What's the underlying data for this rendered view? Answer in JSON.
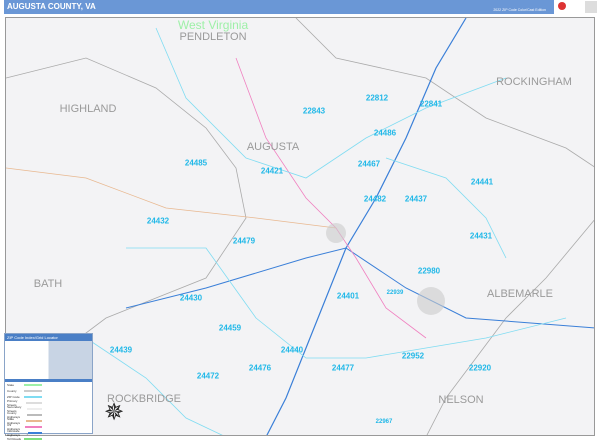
{
  "header": {
    "title": "AUGUSTA COUNTY, VA",
    "edition": "2022 ZIP Code Color/Cast Edition"
  },
  "places": [
    {
      "name": "West Virginia",
      "type": "state"
    },
    {
      "name": "PENDLETON"
    },
    {
      "name": "ROCKINGHAM"
    },
    {
      "name": "HIGHLAND"
    },
    {
      "name": "AUGUSTA"
    },
    {
      "name": "BATH"
    },
    {
      "name": "ALBEMARLE"
    },
    {
      "name": "ROCKBRIDGE"
    },
    {
      "name": "NELSON"
    }
  ],
  "zips": [
    "22812",
    "22841",
    "22843",
    "24486",
    "24485",
    "24421",
    "24467",
    "24441",
    "24482",
    "24437",
    "24432",
    "24479",
    "24431",
    "22980",
    "24430",
    "24401",
    "22939",
    "24459",
    "24439",
    "24440",
    "22952",
    "24472",
    "24476",
    "24477",
    "22920",
    "22967"
  ],
  "legend": {
    "title": "ZIP Code Index/Grid Locator",
    "items": [
      {
        "label": "State",
        "color": "#9ef0a8"
      },
      {
        "label": "County",
        "color": "#cccccc"
      },
      {
        "label": "ZIP Code",
        "color": "#7fdcf2"
      },
      {
        "label": "Primary Streets",
        "color": "#dddddd"
      },
      {
        "label": "Secondary Streets",
        "color": "#eeeeee"
      },
      {
        "label": "County Highways",
        "color": "#bbbbbb"
      },
      {
        "label": "State Highways",
        "color": "#e8b890"
      },
      {
        "label": "US Highways",
        "color": "#f080c0"
      },
      {
        "label": "Interstate Highways",
        "color": "#3a7fd8"
      },
      {
        "label": "Toll Roads",
        "color": "#7ee07e"
      }
    ]
  },
  "colors": {
    "header": "#6a97d6",
    "zip_label": "#21b8e8",
    "place_label": "#9a9a9a"
  }
}
